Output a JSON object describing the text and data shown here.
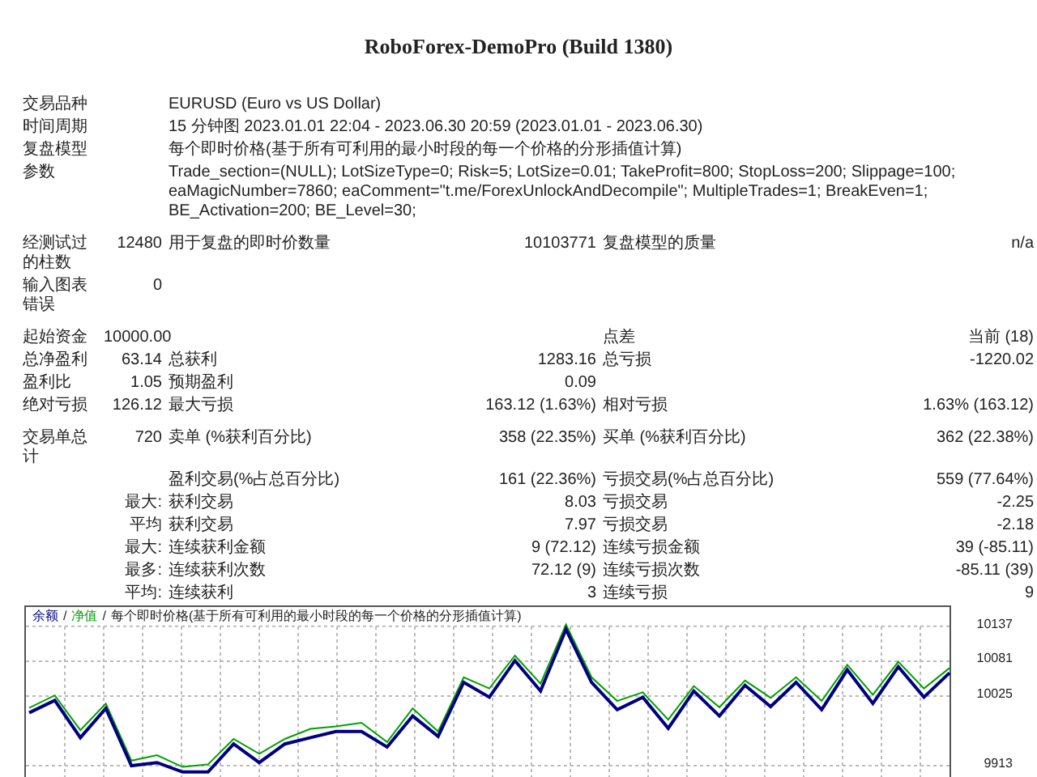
{
  "subtitle": "RoboForex-DemoPro (Build 1380)",
  "summary": [
    {
      "label": "交易品种",
      "value": "EURUSD (Euro vs US Dollar)"
    },
    {
      "label": "时间周期",
      "value": "15 分钟图 2023.01.01 22:04 - 2023.06.30 20:59 (2023.01.01 - 2023.06.30)"
    },
    {
      "label": "复盘模型",
      "value": "每个即时价格(基于所有可利用的最小时段的每一个价格的分形插值计算)"
    },
    {
      "label": "参数",
      "value": "Trade_section=(NULL); LotSizeType=0; Risk=5; LotSize=0.01; TakeProfit=800; StopLoss=200; Slippage=100; eaMagicNumber=7860; eaComment=\"t.me/ForexUnlockAndDecompile\"; MultipleTrades=1; BreakEven=1; BE_Activation=200; BE_Level=30;"
    }
  ],
  "stats": [
    {
      "label": "经测试过的柱数",
      "value": "12480",
      "label_2": "用于复盘的即时价数量",
      "value_2": "10103771",
      "label_3": "复盘模型的质量",
      "value_3": "n/a"
    },
    {
      "label": "输入图表错误",
      "value": "0",
      "gap_after": true
    },
    {
      "label": "起始资金",
      "value": "10000.00",
      "label_3": "点差",
      "value_3": "当前 (18)"
    },
    {
      "label": "总净盈利",
      "value": "63.14",
      "label_2": "总获利",
      "value_2": "1283.16",
      "label_3": "总亏损",
      "value_3": "-1220.02"
    },
    {
      "label": "盈利比",
      "value": "1.05",
      "label_2": "预期盈利",
      "value_2": "0.09"
    },
    {
      "label": "绝对亏损",
      "value": "126.12",
      "label_2": "最大亏损",
      "value_2": "163.12 (1.63%)",
      "label_3": "相对亏损",
      "value_3": "1.63% (163.12)",
      "gap_after": true
    },
    {
      "label": "交易单总计",
      "value": "720",
      "label_2": "卖单 (%获利百分比)",
      "value_2": "358 (22.35%)",
      "label_3": "买单 (%获利百分比)",
      "value_3": "362 (22.38%)"
    },
    {
      "label_2": "盈利交易(%占总百分比)",
      "value_2": "161 (22.36%)",
      "label_3": "亏损交易(%占总百分比)",
      "value_3": "559 (77.64%)"
    },
    {
      "qualifier": "最大:",
      "label_2": "获利交易",
      "value_2": "8.03",
      "label_3": "亏损交易",
      "value_3": "-2.25"
    },
    {
      "qualifier": "平均",
      "label_2": "获利交易",
      "value_2": "7.97",
      "label_3": "亏损交易",
      "value_3": "-2.18"
    },
    {
      "qualifier": "最大:",
      "label_2": "连续获利金额",
      "value_2": "9 (72.12)",
      "label_3": "连续亏损金额",
      "value_3": "39 (-85.11)"
    },
    {
      "qualifier": "最多:",
      "label_2": "连续获利次数",
      "value_2": "72.12 (9)",
      "label_3": "连续亏损次数",
      "value_3": "-85.11 (39)"
    },
    {
      "qualifier": "平均:",
      "label_2": "连续获利",
      "value_2": "3",
      "label_3": "连续亏损",
      "value_3": "9"
    }
  ],
  "chart": {
    "separator": "/",
    "caption": "每个即时价格(基于所有可利用的最小时段的每一个价格的分形插值计算)",
    "chart_data": {
      "type": "line",
      "grid": true,
      "ylim": [
        9887,
        10168
      ],
      "yticks": [
        {
          "value": 10137,
          "label": "10137"
        },
        {
          "value": 10081,
          "label": "10081"
        },
        {
          "value": 10025,
          "label": "10025"
        },
        {
          "value": 9913,
          "label": "9913"
        }
      ],
      "series": [
        {
          "name": "余额",
          "color": "#000080",
          "values": [
            9998,
            10018,
            9958,
            10005,
            9913,
            9918,
            9903,
            9903,
            9948,
            9918,
            9948,
            9958,
            9968,
            9968,
            9943,
            9993,
            9960,
            10047,
            10023,
            10082,
            10033,
            10132,
            10047,
            10003,
            10023,
            9973,
            10033,
            9993,
            10042,
            10008,
            10047,
            10003,
            10067,
            10013,
            10072,
            10023,
            10062
          ]
        },
        {
          "name": "净值",
          "color": "#00a000",
          "values": [
            10006,
            10026,
            9970,
            10013,
            9921,
            9930,
            9911,
            9915,
            9956,
            9932,
            9956,
            9972,
            9976,
            9982,
            9951,
            10005,
            9968,
            10055,
            10037,
            10090,
            10045,
            10140,
            10055,
            10017,
            10031,
            9987,
            10041,
            10007,
            10050,
            10022,
            10055,
            10017,
            10075,
            10027,
            10080,
            10037,
            10070
          ]
        }
      ]
    }
  }
}
